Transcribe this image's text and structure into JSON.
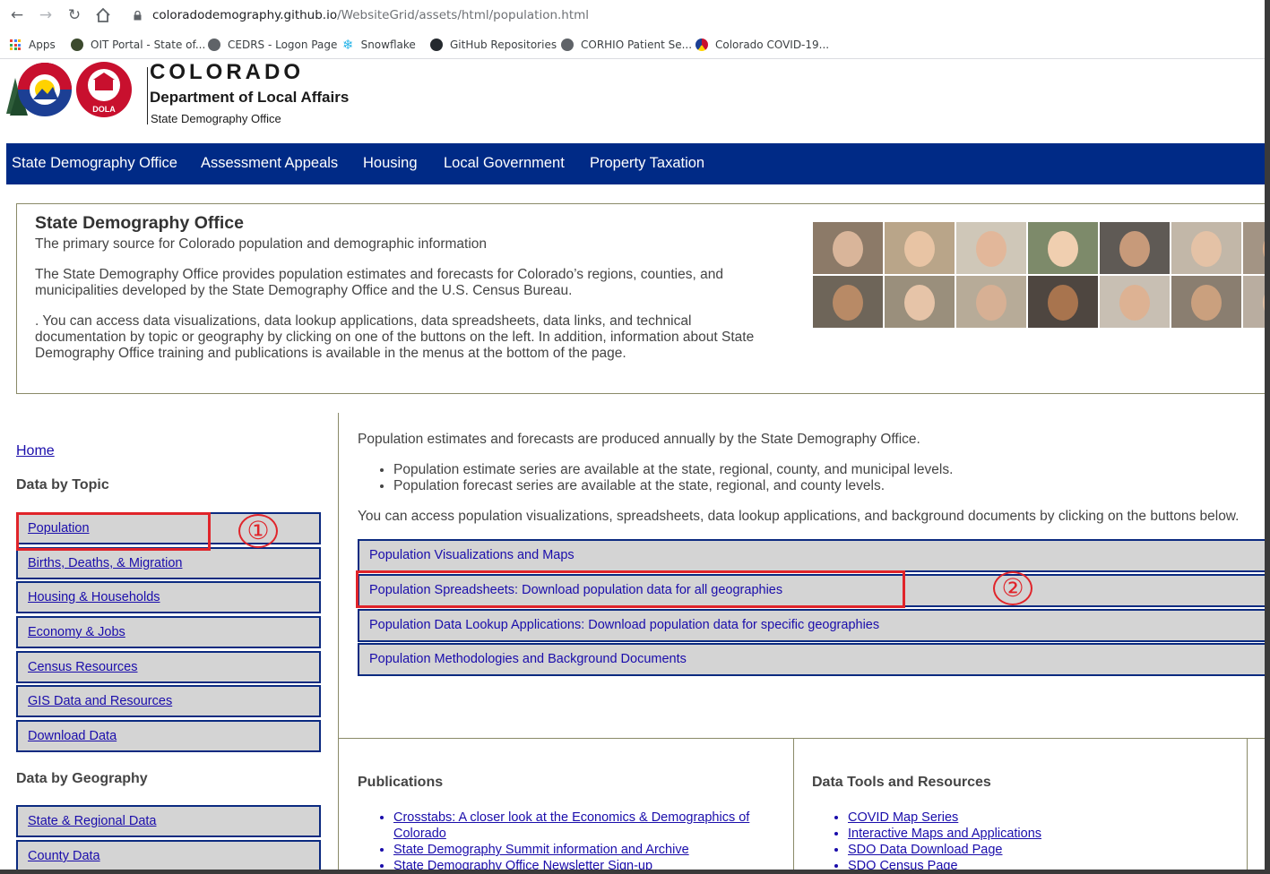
{
  "browser": {
    "url_host": "coloradodemography.github.io",
    "url_path": "/WebsiteGrid/assets/html/population.html",
    "bookmarks": [
      {
        "label": "Apps"
      },
      {
        "label": "OIT Portal - State of..."
      },
      {
        "label": "CEDRS - Logon Page"
      },
      {
        "label": "Snowflake"
      },
      {
        "label": "GitHub Repositories"
      },
      {
        "label": "CORHIO Patient Se..."
      },
      {
        "label": "Colorado COVID-19..."
      }
    ]
  },
  "header": {
    "state": "COLORADO",
    "department": "Department of Local Affairs",
    "office": "State Demography Office",
    "logo_badge": "DOLA"
  },
  "nav": {
    "items": [
      {
        "label": "State Demography Office"
      },
      {
        "label": "Assessment Appeals"
      },
      {
        "label": "Housing"
      },
      {
        "label": "Local Government"
      },
      {
        "label": "Property Taxation"
      }
    ]
  },
  "hero": {
    "title": "State Demography Office",
    "subtitle": "The primary source for Colorado population and demographic information",
    "para1": "The State Demography Office provides population estimates and forecasts for Colorado’s regions, counties, and municipalities developed by the State Demography Office and the U.S. Census Bureau.",
    "para2": ". You can access data visualizations, data lookup applications, data spreadsheets, data links, and technical documentation by topic or geography by clicking on one of the buttons on the left. In addition, information about State Demography Office training and publications is available in the menus at the bottom of the page."
  },
  "sidebar": {
    "home": "Home",
    "topic_heading": "Data by Topic",
    "topics": [
      {
        "label": "Population"
      },
      {
        "label": "Births, Deaths, & Migration"
      },
      {
        "label": "Housing & Households"
      },
      {
        "label": "Economy & Jobs"
      },
      {
        "label": "Census Resources"
      },
      {
        "label": "GIS Data and Resources"
      },
      {
        "label": "Download Data"
      }
    ],
    "geo_heading": "Data by Geography",
    "geographies": [
      {
        "label": "State & Regional Data"
      },
      {
        "label": "County Data"
      }
    ]
  },
  "main": {
    "intro": "Population estimates and forecasts are produced annually by the State Demography Office.",
    "bullets": [
      "Population estimate series are available at the state, regional, county, and municipal levels.",
      "Population forecast series are available at the state, regional, and county levels."
    ],
    "note": "You can access population visualizations, spreadsheets, data lookup applications, and background documents by clicking on the buttons below.",
    "buttons": [
      {
        "label": "Population Visualizations and Maps"
      },
      {
        "label": "Population Spreadsheets: Download population data for all geographies"
      },
      {
        "label": "Population Data Lookup Applications: Download population data for specific geographies"
      },
      {
        "label": "Population Methodologies and Background Documents"
      }
    ]
  },
  "publications": {
    "title": "Publications",
    "links": [
      "Crosstabs: A closer look at the Economics & Demographics of Colorado",
      "State Demography Summit information and Archive",
      "State Demography Office Newsletter Sign-up"
    ]
  },
  "tools": {
    "title": "Data Tools and Resources",
    "links": [
      "COVID Map Series",
      "Interactive Maps and Applications",
      "SDO Data Download Page",
      "SDO Census Page"
    ]
  },
  "annotations": {
    "marker1": "①",
    "marker2": "②",
    "color": "#e0242a"
  },
  "colors": {
    "nav_bg": "#002a86",
    "button_bg": "#d4d4d4",
    "button_border": "#0b2a80",
    "link": "#1a0dab"
  }
}
